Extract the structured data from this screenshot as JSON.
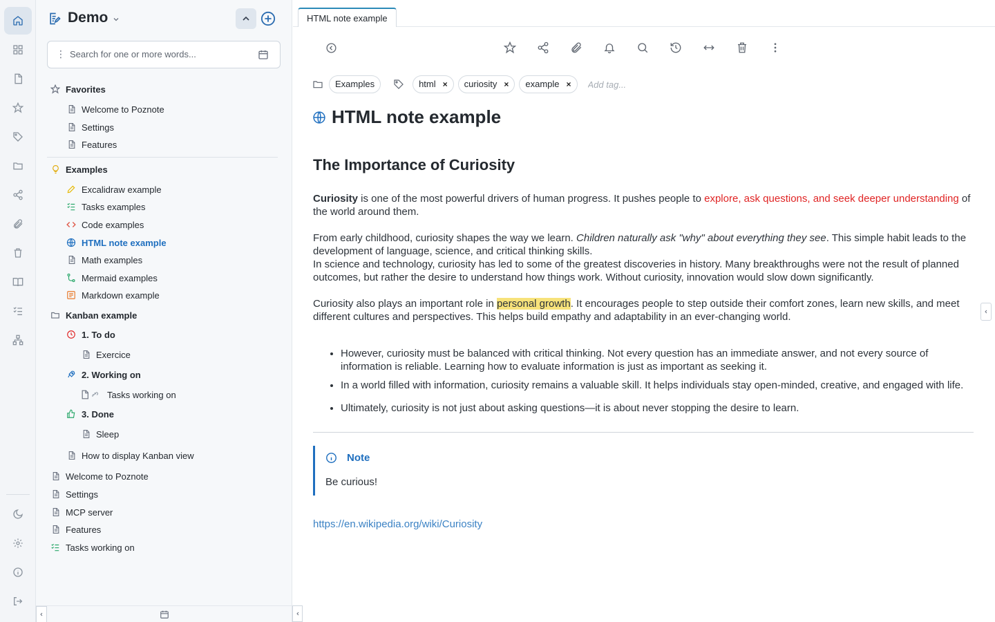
{
  "notebook": {
    "title": "Demo"
  },
  "search": {
    "placeholder": "Search for one or more words..."
  },
  "tree": [
    {
      "label": "Favorites",
      "level": 0,
      "bold": true,
      "icon": "star-icon"
    },
    {
      "label": "Welcome to Poznote",
      "level": 1,
      "icon": "document-icon"
    },
    {
      "label": "Settings",
      "level": 1,
      "icon": "document-icon"
    },
    {
      "label": "Features",
      "level": 1,
      "icon": "document-icon"
    },
    {
      "label": "Examples",
      "level": 0,
      "bold": true,
      "icon": "lightbulb-icon"
    },
    {
      "label": "Excalidraw example",
      "level": 1,
      "icon": "pencil-icon"
    },
    {
      "label": "Tasks examples",
      "level": 1,
      "icon": "checklist-icon"
    },
    {
      "label": "Code examples",
      "level": 1,
      "icon": "code-icon"
    },
    {
      "label": "HTML note example",
      "level": 1,
      "icon": "globe-icon",
      "active": true
    },
    {
      "label": "Math examples",
      "level": 1,
      "icon": "document-icon"
    },
    {
      "label": "Mermaid examples",
      "level": 1,
      "icon": "diagram-icon"
    },
    {
      "label": "Markdown example",
      "level": 1,
      "icon": "markdown-icon"
    },
    {
      "label": "Kanban example",
      "level": 0,
      "bold": true,
      "icon": "folder-icon"
    },
    {
      "label": "1. To do",
      "level": 1,
      "bold": true,
      "icon": "clock-icon"
    },
    {
      "label": "Exercice",
      "level": 2,
      "icon": "document-icon"
    },
    {
      "label": "2. Working on",
      "level": 1,
      "bold": true,
      "icon": "rocket-icon"
    },
    {
      "label": "Tasks working on",
      "level": 2,
      "icon": "linked-document-icon"
    },
    {
      "label": "3. Done",
      "level": 1,
      "bold": true,
      "icon": "thumbs-up-icon"
    },
    {
      "label": "Sleep",
      "level": 2,
      "icon": "document-icon"
    },
    {
      "label": "How to display Kanban view",
      "level": 1,
      "icon": "document-icon"
    },
    {
      "label": "Welcome to Poznote",
      "level": 0,
      "icon": "document-icon"
    },
    {
      "label": "Settings",
      "level": 0,
      "icon": "document-icon"
    },
    {
      "label": "MCP server",
      "level": 0,
      "icon": "document-icon"
    },
    {
      "label": "Features",
      "level": 0,
      "icon": "document-icon"
    },
    {
      "label": "Tasks working on",
      "level": 0,
      "icon": "checklist-icon"
    }
  ],
  "tab": {
    "label": "HTML note example"
  },
  "tags": {
    "folder": "Examples",
    "items": [
      "html",
      "curiosity",
      "example"
    ],
    "remove_glyph": "×",
    "add_placeholder": "Add tag..."
  },
  "note": {
    "title": "HTML note example",
    "heading": "The Importance of Curiosity",
    "p1_bold": "Curiosity",
    "p1_a": " is one of the most powerful drivers of human progress. It pushes people to ",
    "p1_red": "explore, ask questions, and seek deeper understanding",
    "p1_b": " of the world around them.",
    "p2_a": "From early childhood, curiosity shapes the way we learn. ",
    "p2_italic": "Children naturally ask \"why\" about everything they see",
    "p2_b": ". This simple habit leads to the development of language, science, and critical thinking skills.",
    "p2_c": "In science and technology, curiosity has led to some of the greatest discoveries in history. Many breakthroughs were not the result of planned outcomes, but rather the desire to understand how things work. Without curiosity, innovation would slow down significantly.",
    "p3_a": "Curiosity also plays an important role in ",
    "p3_mark": "personal growth",
    "p3_b": ". It encourages people to step outside their comfort zones, learn new skills, and meet different cultures and perspectives. This helps build empathy and adaptability in an ever-changing world.",
    "bullets": [
      "However, curiosity must be balanced with critical thinking. Not every question has an immediate answer, and not every source of information is reliable. Learning how to evaluate information is just as important as seeking it.",
      "In a world filled with information, curiosity remains a valuable skill. It helps individuals stay open-minded, creative, and engaged with life.",
      "Ultimately, curiosity is not just about asking questions—it is about never stopping the desire to learn."
    ],
    "callout_title": "Note",
    "callout_body": "Be curious!",
    "link": "https://en.wikipedia.org/wiki/Curiosity"
  },
  "colors": {
    "accent": "#2b6cb0",
    "active_text": "#1f6fbf",
    "red_text": "#e02424",
    "highlight": "#f7e27a",
    "link": "#3b82c4"
  }
}
